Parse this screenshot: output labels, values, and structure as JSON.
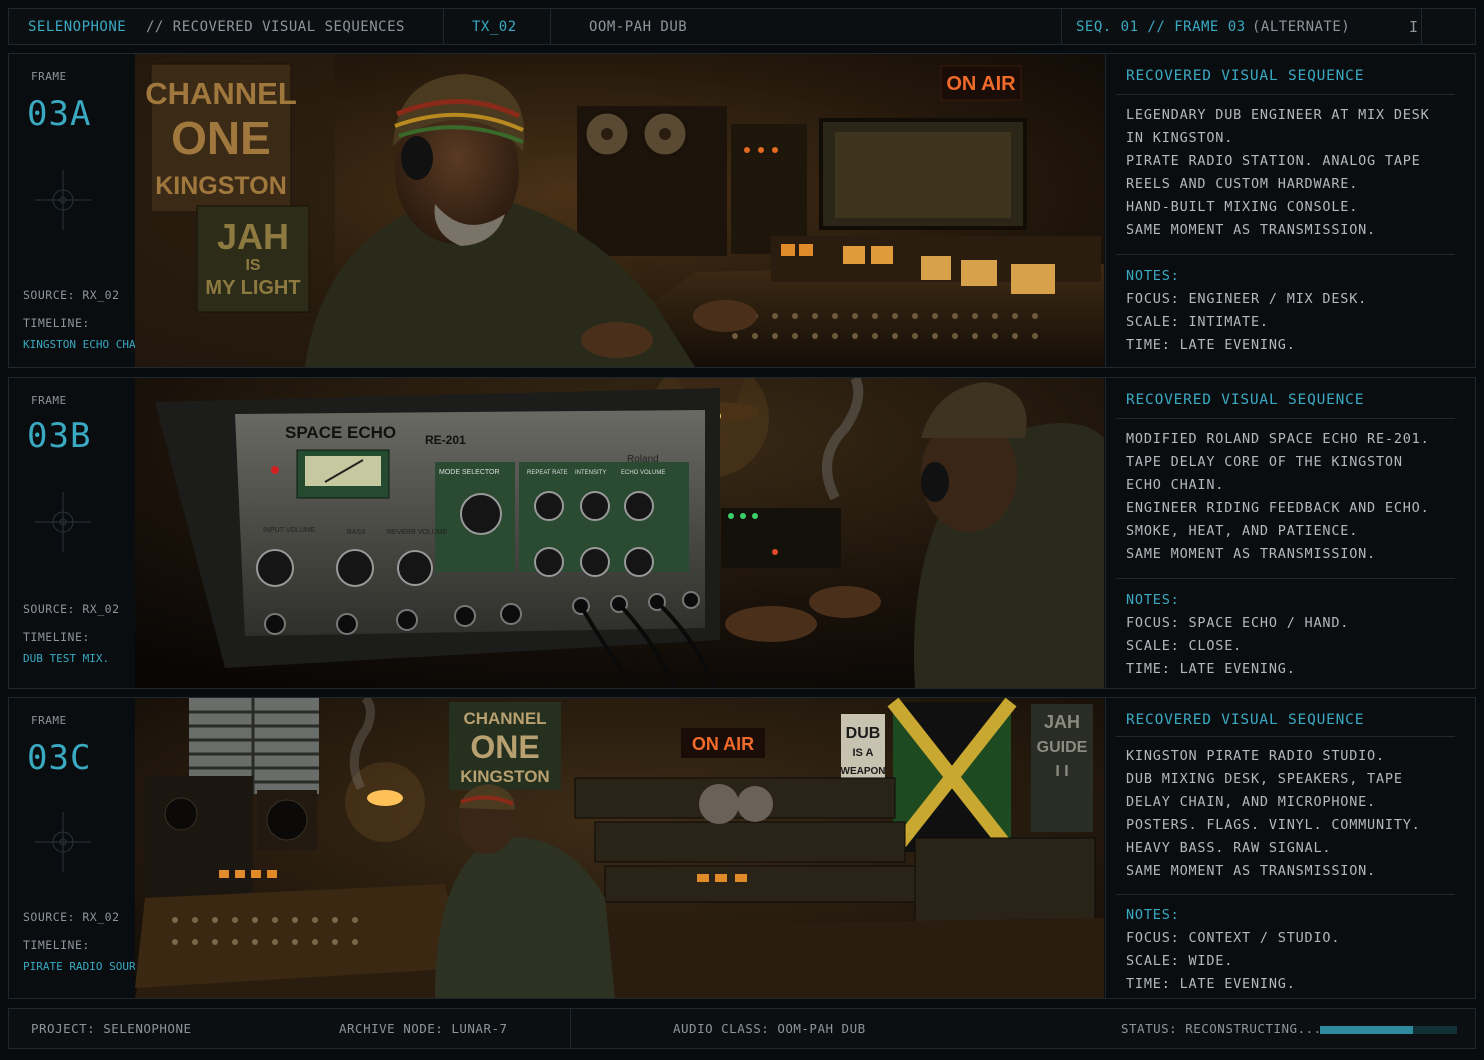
{
  "topbar": {
    "brand": "SELENOPHONE",
    "section": "// RECOVERED VISUAL SEQUENCES",
    "tx": "TX_02",
    "track": "OOM-PAH DUB",
    "seq": "SEQ. 01 // FRAME 03",
    "seq_note": "(ALTERNATE)"
  },
  "frames": [
    {
      "frame_label": "FRAME",
      "code": "03A",
      "source": "SOURCE: RX_02",
      "timeline_label": "TIMELINE:",
      "timeline": "KINGSTON ECHO CHAIN.",
      "heading": "RECOVERED VISUAL SEQUENCE",
      "desc": [
        "LEGENDARY DUB ENGINEER AT MIX DESK",
        "IN KINGSTON.",
        "PIRATE RADIO STATION. ANALOG TAPE",
        "REELS AND CUSTOM HARDWARE.",
        "HAND-BUILT MIXING CONSOLE.",
        "SAME MOMENT AS TRANSMISSION."
      ],
      "notes_label": "NOTES:",
      "notes": [
        "FOCUS: ENGINEER / MIX DESK.",
        "SCALE: INTIMATE.",
        "TIME: LATE EVENING."
      ],
      "scene_text": {
        "poster1": [
          "CHANNEL",
          "ONE",
          "KINGSTON"
        ],
        "poster2": [
          "JAH",
          "IS",
          "MY LIGHT"
        ],
        "sign": "ON AIR"
      }
    },
    {
      "frame_label": "FRAME",
      "code": "03B",
      "source": "SOURCE: RX_02",
      "timeline_label": "TIMELINE:",
      "timeline": "DUB TEST MIX.",
      "heading": "RECOVERED VISUAL SEQUENCE",
      "desc": [
        "MODIFIED ROLAND SPACE ECHO RE-201.",
        "TAPE DELAY CORE OF THE KINGSTON",
        "ECHO CHAIN.",
        "ENGINEER RIDING FEEDBACK AND ECHO.",
        "SMOKE, HEAT, AND PATIENCE.",
        "SAME MOMENT AS TRANSMISSION."
      ],
      "notes_label": "NOTES:",
      "notes": [
        "FOCUS: SPACE ECHO / HAND.",
        "SCALE: CLOSE.",
        "TIME: LATE EVENING."
      ],
      "scene_text": {
        "device": "SPACE ECHO",
        "model": "RE-201",
        "brand": "Roland",
        "mode": "MODE SELECTOR",
        "bass": "BASS",
        "input": "INPUT VOLUME",
        "reverb": "REVERB VOLUME",
        "repeat": "REPEAT RATE",
        "intensity": "INTENSITY",
        "echo": "ECHO VOLUME"
      }
    },
    {
      "frame_label": "FRAME",
      "code": "03C",
      "source": "SOURCE: RX_02",
      "timeline_label": "TIMELINE:",
      "timeline": "PIRATE RADIO SOURCE.",
      "heading": "RECOVERED VISUAL SEQUENCE",
      "desc": [
        "KINGSTON PIRATE RADIO STUDIO.",
        "DUB MIXING DESK, SPEAKERS, TAPE",
        "DELAY CHAIN, AND MICROPHONE.",
        "POSTERS. FLAGS. VINYL. COMMUNITY.",
        "HEAVY BASS. RAW SIGNAL.",
        "SAME MOMENT AS TRANSMISSION."
      ],
      "notes_label": "NOTES:",
      "notes": [
        "FOCUS: CONTEXT / STUDIO.",
        "SCALE: WIDE.",
        "TIME: LATE EVENING."
      ],
      "scene_text": {
        "poster1": [
          "CHANNEL",
          "ONE",
          "KINGSTON"
        ],
        "sign": "ON AIR",
        "poster2": [
          "DUB",
          "IS A",
          "WEAPON"
        ],
        "poster3": [
          "JAH",
          "GUIDE",
          "I I"
        ]
      }
    }
  ],
  "footer": {
    "project": "PROJECT: SELENOPHONE",
    "node": "ARCHIVE NODE: LUNAR-7",
    "audio": "AUDIO CLASS: OOM-PAH DUB",
    "status": "STATUS: RECONSTRUCTING...",
    "progress": 0.68
  },
  "colors": {
    "accent": "#3aa9c2",
    "background": "#090c0f",
    "border": "#1f282e",
    "warm": "#c8761f"
  }
}
